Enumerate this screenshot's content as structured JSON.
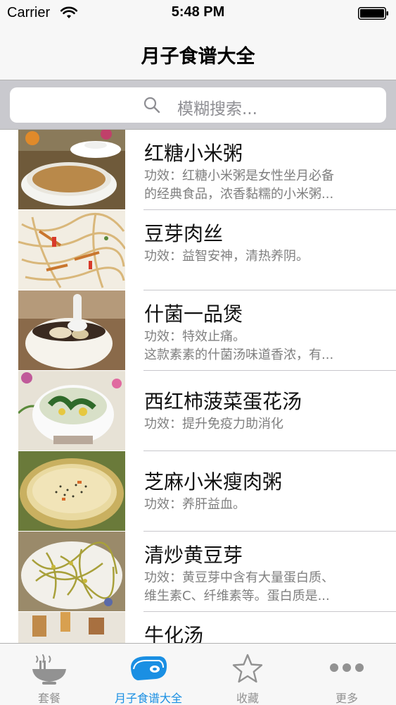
{
  "status_bar": {
    "carrier": "Carrier",
    "time": "5:48 PM"
  },
  "nav": {
    "title": "月子食谱大全"
  },
  "search": {
    "placeholder": "模糊搜索..."
  },
  "recipes": [
    {
      "title": "红糖小米粥",
      "desc_lines": [
        "功效：红糖小米粥是女性坐月必备",
        "的经典食品，浓香黏糯的小米粥..."
      ]
    },
    {
      "title": "豆芽肉丝",
      "desc_lines": [
        "功效：益智安神，清热养阴。"
      ]
    },
    {
      "title": "什菌一品煲",
      "desc_lines": [
        "功效：特效止痛。",
        "这款素素的什菌汤味道香浓，有..."
      ]
    },
    {
      "title": "西红柿菠菜蛋花汤",
      "desc_lines": [
        "功效：提升免疫力助消化"
      ]
    },
    {
      "title": "芝麻小米瘦肉粥",
      "desc_lines": [
        "功效：养肝益血。"
      ]
    },
    {
      "title": "清炒黄豆芽",
      "desc_lines": [
        "功效：黄豆芽中含有大量蛋白质、",
        "维生素C、纤维素等。蛋白质是..."
      ]
    },
    {
      "title": "牛化汤",
      "desc_lines": []
    }
  ],
  "tabs": [
    {
      "label": "套餐",
      "icon": "bowl-icon",
      "active": false
    },
    {
      "label": "月子食谱大全",
      "icon": "meat-icon",
      "active": true
    },
    {
      "label": "收藏",
      "icon": "star-icon",
      "active": false
    },
    {
      "label": "更多",
      "icon": "more-icon",
      "active": false
    }
  ],
  "colors": {
    "accent": "#1a8fe3",
    "inactive": "#929292",
    "search_bg": "#c9c9ce",
    "bar_bg": "#f7f7f7"
  }
}
